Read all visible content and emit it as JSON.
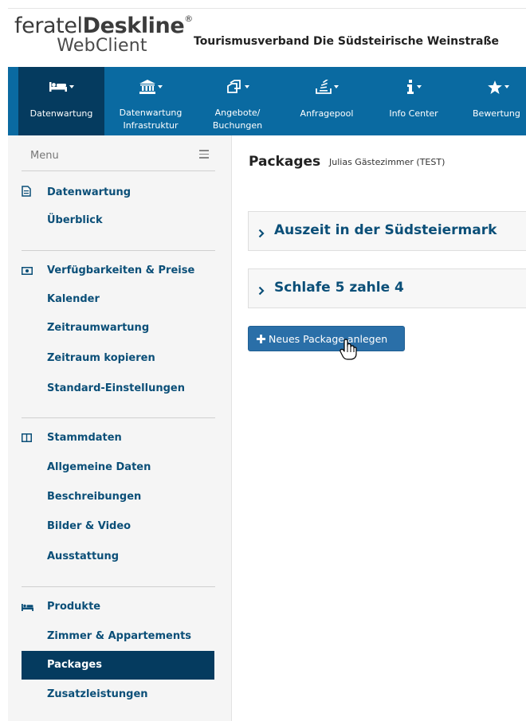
{
  "header": {
    "logo_feratel": "feratel",
    "logo_deskline": "Deskline",
    "logo_reg": "®",
    "logo_webclient": "WebClient",
    "org_title": "Tourismusverband Die Südsteirische Weinstraße"
  },
  "topnav": {
    "items": [
      {
        "icon": "bed-icon",
        "label": "Datenwartung",
        "active": true
      },
      {
        "icon": "institution-icon",
        "label_line1": "Datenwartung",
        "label_line2": "Infrastruktur"
      },
      {
        "icon": "offers-icon",
        "label_line1": "Angebote/",
        "label_line2": "Buchungen"
      },
      {
        "icon": "inquiry-pool-icon",
        "label": "Anfragepool"
      },
      {
        "icon": "info-icon",
        "label": "Info Center"
      },
      {
        "icon": "star-icon",
        "label": "Bewertung"
      }
    ]
  },
  "sidebar": {
    "menu_label": "Menu",
    "sections": [
      {
        "icon": "document-icon",
        "title": "Datenwartung",
        "items": [
          "Überblick"
        ]
      },
      {
        "icon": "money-icon",
        "title": "Verfügbarkeiten & Preise",
        "items": [
          "Kalender",
          "Zeitraumwartung",
          "Zeitraum kopieren",
          "Standard-Einstellungen"
        ]
      },
      {
        "icon": "columns-icon",
        "title": "Stammdaten",
        "items": [
          "Allgemeine Daten",
          "Beschreibungen",
          "Bilder & Video",
          "Ausstattung"
        ]
      },
      {
        "icon": "bed-icon",
        "title": "Produkte",
        "items": [
          "Zimmer & Appartements",
          "Packages",
          "Zusatzleistungen"
        ],
        "active_item": "Packages"
      }
    ]
  },
  "main": {
    "title": "Packages",
    "subtitle": "Julias Gästezimmer (TEST)",
    "packages": [
      "Auszeit in der Südsteiermark",
      "Schlafe 5 zahle 4"
    ],
    "add_button": "Neues Package anlegen"
  },
  "colors": {
    "nav_bg": "#0a6aa1",
    "nav_active": "#053b5f",
    "link": "#0b4f78",
    "button": "#2a6fa8"
  }
}
